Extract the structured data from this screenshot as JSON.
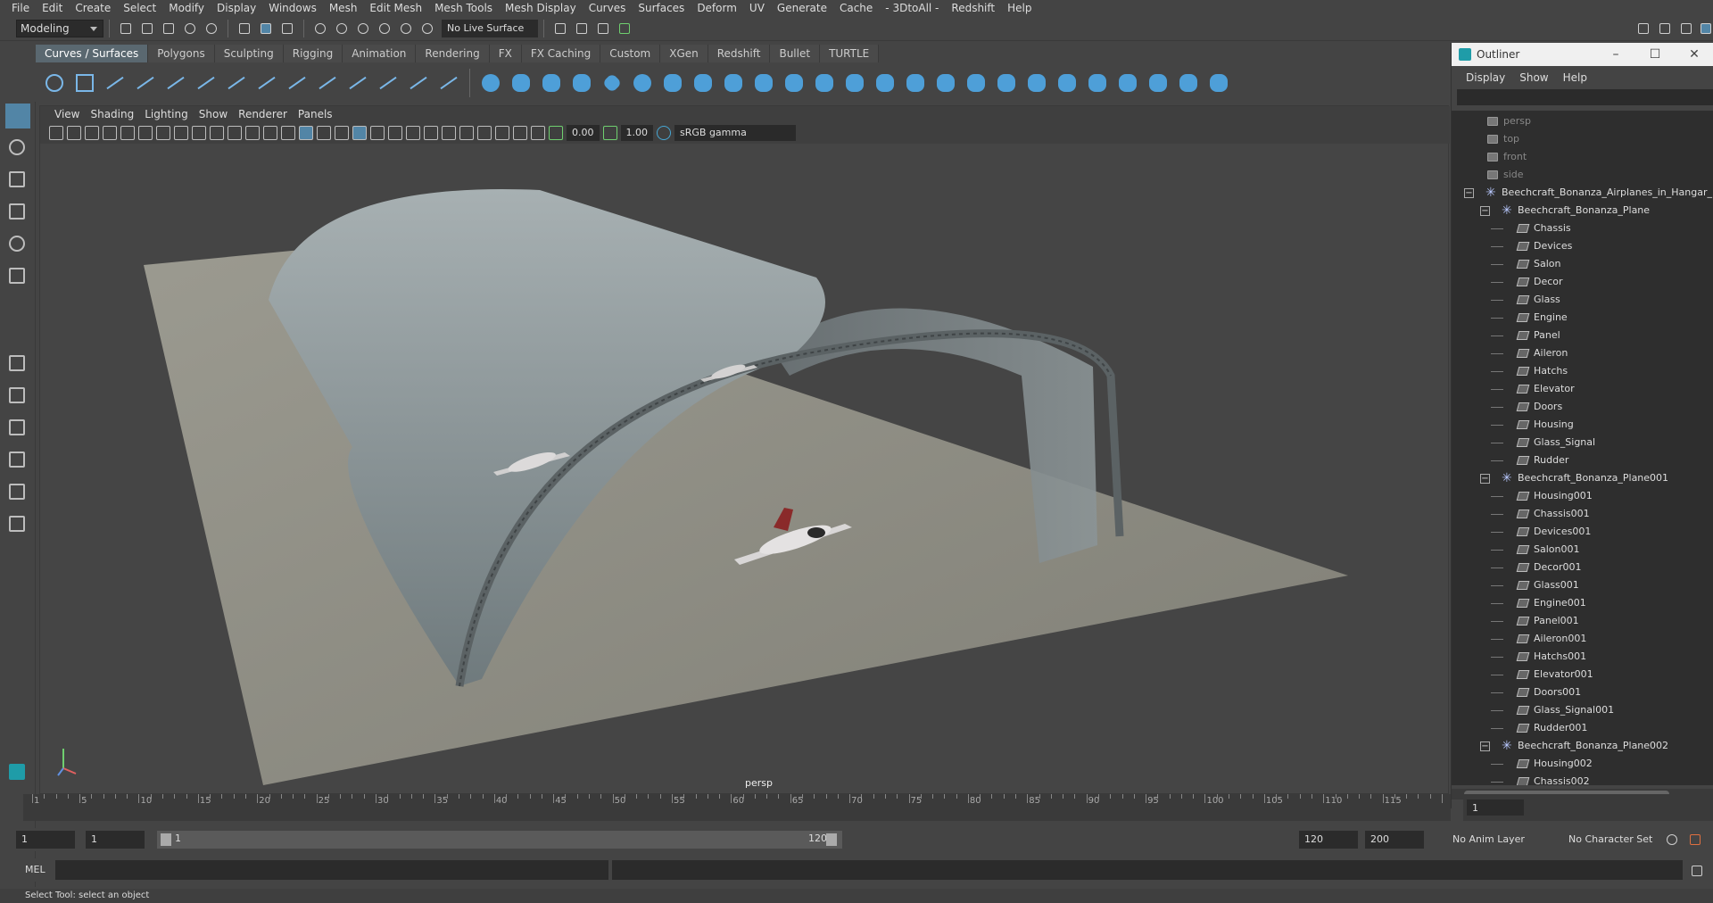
{
  "menu": [
    "File",
    "Edit",
    "Create",
    "Select",
    "Modify",
    "Display",
    "Windows",
    "Mesh",
    "Edit Mesh",
    "Mesh Tools",
    "Mesh Display",
    "Curves",
    "Surfaces",
    "Deform",
    "UV",
    "Generate",
    "Cache",
    "- 3DtoAll -",
    "Redshift",
    "Help"
  ],
  "status": {
    "mode": "Modeling",
    "live_surface": "No Live Surface"
  },
  "shelf_tabs": [
    "Curves / Surfaces",
    "Polygons",
    "Sculpting",
    "Rigging",
    "Animation",
    "Rendering",
    "FX",
    "FX Caching",
    "Custom",
    "XGen",
    "Redshift",
    "Bullet",
    "TURTLE"
  ],
  "viewport": {
    "menu": [
      "View",
      "Shading",
      "Lighting",
      "Show",
      "Renderer",
      "Panels"
    ],
    "exposure": "0.00",
    "gamma": "1.00",
    "color_space": "sRGB gamma",
    "camera_label": "persp"
  },
  "outliner": {
    "title": "Outliner",
    "menu": [
      "Display",
      "Show",
      "Help"
    ],
    "cameras": [
      "persp",
      "top",
      "front",
      "side"
    ],
    "root": "Beechcraft_Bonanza_Airplanes_in_Hangar_n",
    "groups": [
      {
        "name": "Beechcraft_Bonanza_Plane",
        "children": [
          "Chassis",
          "Devices",
          "Salon",
          "Decor",
          "Glass",
          "Engine",
          "Panel",
          "Aileron",
          "Hatchs",
          "Elevator",
          "Doors",
          "Housing",
          "Glass_Signal",
          "Rudder"
        ]
      },
      {
        "name": "Beechcraft_Bonanza_Plane001",
        "children": [
          "Housing001",
          "Chassis001",
          "Devices001",
          "Salon001",
          "Decor001",
          "Glass001",
          "Engine001",
          "Panel001",
          "Aileron001",
          "Hatchs001",
          "Elevator001",
          "Doors001",
          "Glass_Signal001",
          "Rudder001"
        ]
      },
      {
        "name": "Beechcraft_Bonanza_Plane002",
        "children": [
          "Housing002",
          "Chassis002"
        ]
      }
    ]
  },
  "timeline": {
    "ticks": [
      "1",
      "5",
      "10",
      "15",
      "20",
      "25",
      "30",
      "35",
      "40",
      "45",
      "50",
      "55",
      "60",
      "65",
      "70",
      "75",
      "80",
      "85",
      "90",
      "95",
      "100",
      "105",
      "110",
      "115"
    ],
    "current": "1"
  },
  "range": {
    "start": "1",
    "playback_start": "1",
    "slider_start": "1",
    "slider_end": "120",
    "playback_end": "120",
    "end": "200",
    "anim_layer": "No Anim Layer",
    "character_set": "No Character Set"
  },
  "command": {
    "label": "MEL"
  },
  "help_line": "Select Tool: select an object",
  "colors": {
    "accent": "#5285a6",
    "shelf_icon": "#7ab7e8",
    "hangar": "#8a9599",
    "floor": "#8e8e84"
  }
}
